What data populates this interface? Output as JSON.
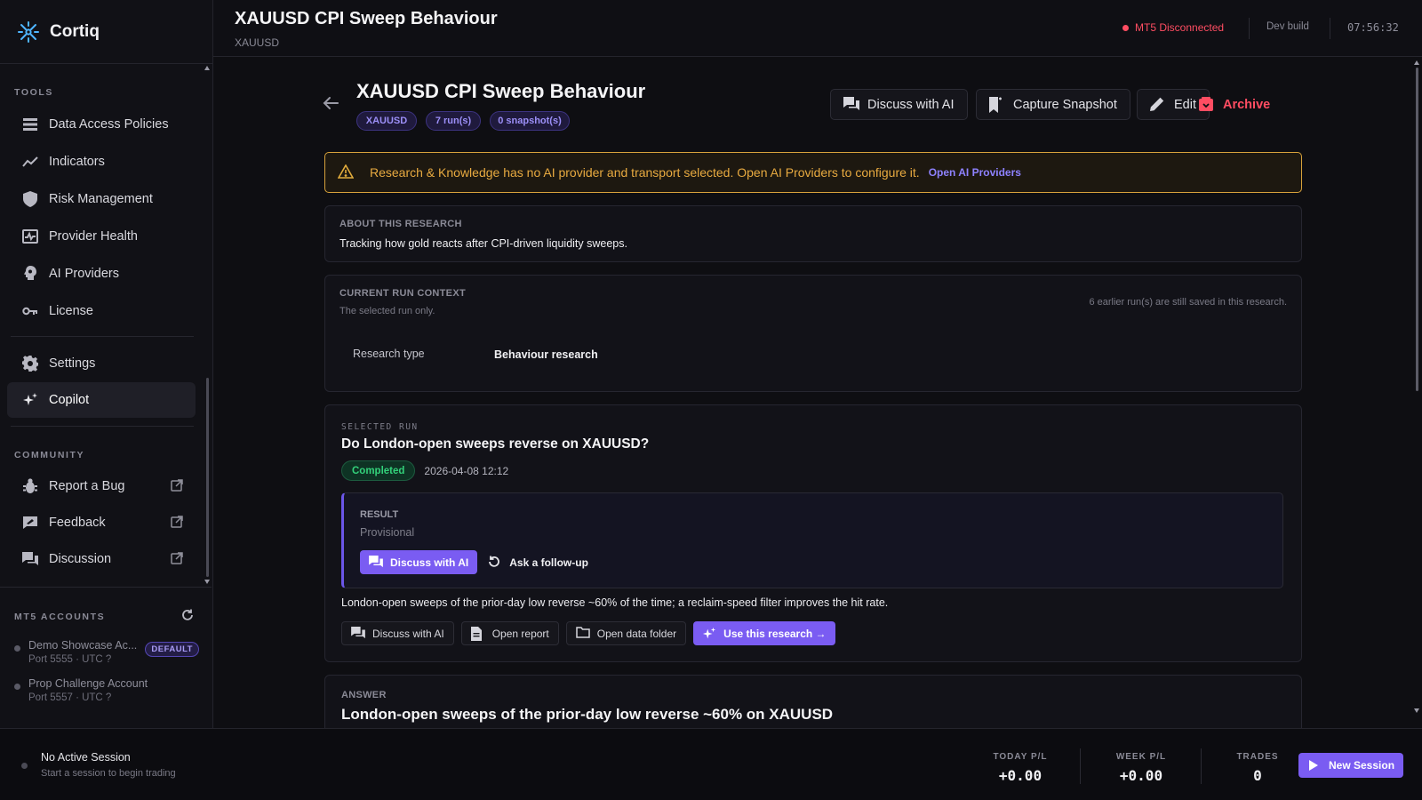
{
  "app": {
    "name": "Cortiq"
  },
  "sidebar": {
    "tools_label": "TOOLS",
    "tools": [
      {
        "label": "Data Access Policies",
        "icon": "list-icon"
      },
      {
        "label": "Indicators",
        "icon": "trend-icon"
      },
      {
        "label": "Risk Management",
        "icon": "shield-icon"
      },
      {
        "label": "Provider Health",
        "icon": "pulse-icon"
      },
      {
        "label": "AI Providers",
        "icon": "brain-icon"
      },
      {
        "label": "License",
        "icon": "key-icon"
      }
    ],
    "settings_label": "Settings",
    "copilot_label": "Copilot",
    "community_label": "COMMUNITY",
    "community": [
      {
        "label": "Report a Bug",
        "icon": "bug-icon"
      },
      {
        "label": "Feedback",
        "icon": "feedback-icon"
      },
      {
        "label": "Discussion",
        "icon": "chat-icon"
      }
    ],
    "mt5_label": "MT5 ACCOUNTS",
    "accounts": [
      {
        "name": "Demo Showcase Ac...",
        "port": "Port 5555 · UTC ?",
        "badge": "DEFAULT"
      },
      {
        "name": "Prop Challenge Account",
        "port": "Port 5557 · UTC ?"
      }
    ]
  },
  "header": {
    "title": "XAUUSD CPI Sweep Behaviour",
    "subtitle": "XAUUSD",
    "mt5_status": "MT5 Disconnected",
    "build": "Dev build",
    "clock": "07:56:32"
  },
  "page": {
    "title": "XAUUSD CPI Sweep Behaviour",
    "tags": [
      "XAUUSD",
      "7 run(s)",
      "0 snapshot(s)"
    ],
    "actions": {
      "discuss": "Discuss with AI",
      "snapshot": "Capture Snapshot",
      "edit": "Edit",
      "archive": "Archive"
    },
    "warning": {
      "text": "Research & Knowledge has no AI provider and transport selected. Open AI Providers to configure it.",
      "link": "Open AI Providers"
    },
    "about": {
      "label": "ABOUT THIS RESEARCH",
      "text": "Tracking how gold reacts after CPI-driven liquidity sweeps."
    },
    "context": {
      "label": "CURRENT RUN CONTEXT",
      "sub": "The selected run only.",
      "note": "6 earlier run(s) are still saved in this research.",
      "key": "Research type",
      "value": "Behaviour research"
    },
    "run": {
      "label": "SELECTED RUN",
      "question": "Do London-open sweeps reverse on XAUUSD?",
      "status": "Completed",
      "date": "2026-04-08 12:12",
      "result_label": "RESULT",
      "result_state": "Provisional",
      "discuss": "Discuss with AI",
      "followup": "Ask a follow-up",
      "summary": "London-open sweeps of the prior-day low reverse ~60% of the time; a reclaim-speed filter improves the hit rate.",
      "btn_discuss": "Discuss with AI",
      "btn_report": "Open report",
      "btn_folder": "Open data folder",
      "btn_use": "Use this research →"
    },
    "answer": {
      "label": "ANSWER",
      "title": "London-open sweeps of the prior-day low reverse ~60% on XAUUSD"
    }
  },
  "footer": {
    "session_title": "No Active Session",
    "session_sub": "Start a session to begin trading",
    "today_label": "TODAY P/L",
    "today_value": "+0.00",
    "week_label": "WEEK P/L",
    "week_value": "+0.00",
    "trades_label": "TRADES",
    "trades_value": "0",
    "new_session": "New Session"
  },
  "colors": {
    "accent": "#7a5cf2",
    "danger": "#ff4d62",
    "warning": "#e8aa40",
    "success": "#33d17a"
  }
}
